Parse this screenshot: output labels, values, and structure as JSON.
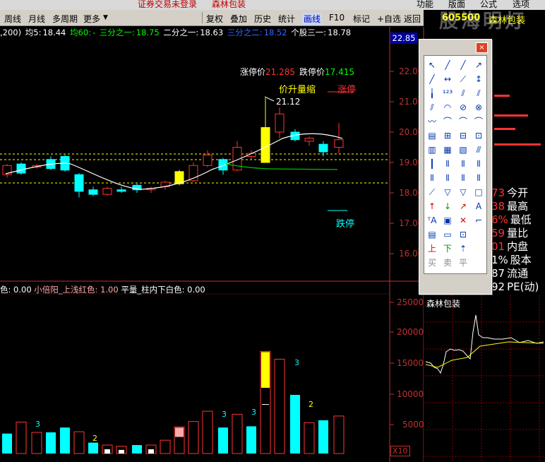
{
  "topbar": {
    "left_status": "证券交易未登录",
    "stock_name": "森林包装",
    "menus": [
      "功能",
      "版面",
      "公式",
      "选项"
    ]
  },
  "toolbar": {
    "left_items": [
      "周线",
      "月线",
      "多周期",
      "更多"
    ],
    "right_items": [
      "复权",
      "叠加",
      "历史",
      "统计",
      "画线",
      "F10",
      "标记",
      "+自选",
      "返回"
    ],
    "active_item": "画线"
  },
  "header": {
    "code": "605500",
    "name": "森林包装",
    "watermark": "股海明灯"
  },
  "indicator_line": {
    "prefix": ",200)",
    "ma5_label": "均5:",
    "ma5_value": "18.44",
    "ma60_label": "均60:",
    "ma60_value": "-",
    "third1_label": "三分之一:",
    "third1_value": "18.75",
    "half_label": "二分之一:",
    "half_value": "18.63",
    "twothird_label": "三分之二:",
    "twothird_value": "18.52",
    "stock_third_label": "个股三一:",
    "stock_third_value": "18.78",
    "current_price": "22.85"
  },
  "price_axis": [
    "22.00",
    "21.00",
    "20.00",
    "19.00",
    "18.00",
    "17.00",
    "16.00"
  ],
  "annotations": {
    "limit_up_label": "涨停价",
    "limit_up_value": "21.285",
    "limit_down_label": "跌停价",
    "limit_down_value": "17.415",
    "price_up_volume_shrink": "价升量缩",
    "limit_up_mark": "涨停",
    "limit_down_mark": "跌停",
    "high_price": "21.12"
  },
  "volume_indicator": {
    "text1": "色: 0.00",
    "text2": "小倍阳_上浅红色: 1.00",
    "text3": "平量_柱内下白色: 0.00"
  },
  "volume_axis": [
    "25000",
    "20000",
    "15000",
    "10000",
    "5000"
  ],
  "volume_multiplier": "X10",
  "volume_bar_labels": [
    "3",
    "2",
    "3",
    "3",
    "3",
    "2"
  ],
  "quote_panel": {
    "rows": [
      {
        "value": "73",
        "label": "今开"
      },
      {
        "value": "38",
        "label": "最高"
      },
      {
        "value": "6%",
        "label": "最低"
      },
      {
        "value": "59",
        "label": "量比"
      },
      {
        "value": "01",
        "label": "内盘"
      },
      {
        "value": "1%",
        "label": "股本"
      },
      {
        "value": "87",
        "label": "流通"
      },
      {
        "value": "92",
        "label": "PE(动)"
      }
    ]
  },
  "mini_chart": {
    "title": "森林包装"
  },
  "palette": {
    "close_label": "×",
    "buy_label": "买",
    "sell_label": "卖",
    "flat_label": "平",
    "up_label": "上",
    "down_label": "下"
  },
  "colors": {
    "up": "#ff3333",
    "down": "#00ffff",
    "background": "#000000"
  }
}
